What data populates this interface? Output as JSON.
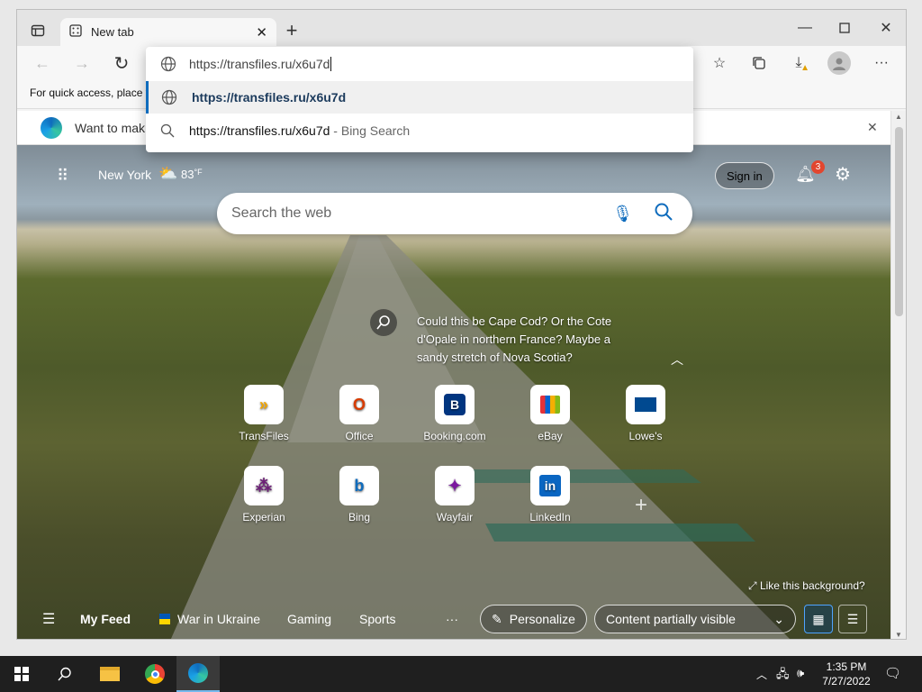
{
  "browser": {
    "tab_title": "New tab",
    "address_value": "https://transfiles.ru/x6u7d",
    "favbar_text": "For quick access, place y",
    "infobar_text": "Want to mak"
  },
  "dropdown": {
    "suggestion_url": "https://transfiles.ru/x6u7d",
    "search_query": "https://transfiles.ru/x6u7d",
    "search_suffix": " - Bing Search"
  },
  "newtab": {
    "location": "New York",
    "temperature": "83",
    "temp_unit": "°F",
    "sign_in": "Sign in",
    "notif_count": "3",
    "search_placeholder": "Search the web",
    "caption": "Could this be Cape Cod? Or the Cote d'Opale in northern France? Maybe a sandy stretch of Nova Scotia?",
    "like_bg": "Like this background?",
    "tiles": [
      {
        "label": "TransFiles"
      },
      {
        "label": "Office"
      },
      {
        "label": "Booking.com"
      },
      {
        "label": "eBay"
      },
      {
        "label": "Lowe's"
      },
      {
        "label": "Experian"
      },
      {
        "label": "Bing"
      },
      {
        "label": "Wayfair"
      },
      {
        "label": "LinkedIn"
      }
    ],
    "feed": {
      "my_feed": "My Feed",
      "war": "War in Ukraine",
      "gaming": "Gaming",
      "sports": "Sports",
      "more": "···",
      "personalize": "Personalize",
      "content_vis": "Content partially visible"
    }
  },
  "taskbar": {
    "time": "1:35 PM",
    "date": "7/27/2022"
  },
  "colors": {
    "accent": "#0f6cbd",
    "tile_booking": "#003580",
    "tile_linkedin": "#0a66c2",
    "tile_office": "#d83b01"
  }
}
